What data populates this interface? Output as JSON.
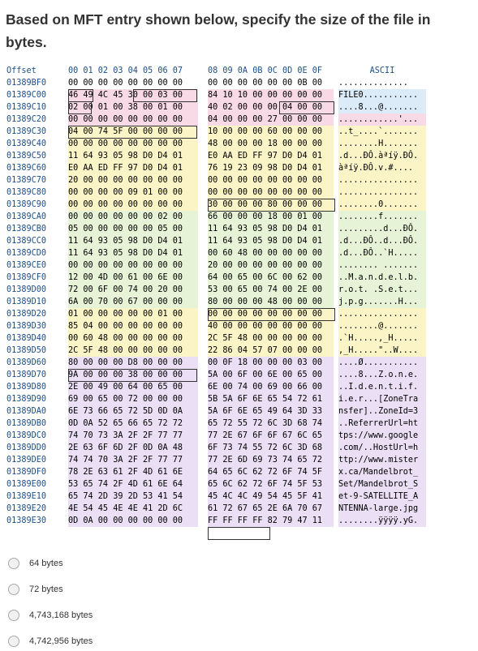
{
  "question": {
    "text": "Based on MFT entry shown below, specify the size of the file in bytes."
  },
  "hexdump": {
    "header": {
      "offset": "Offset",
      "g1": "00 01 02 03 04 05 06 07",
      "g2": "08 09 0A 0B 0C 0D 0E 0F",
      "ascii": "ASCII"
    },
    "rows": [
      {
        "off": "01389BF0",
        "g1": "00 00 00 00 00 00 00 00",
        "g2": "00 00 00 00 00 00 0B 00",
        "ascii": "..............",
        "c": "none"
      },
      {
        "off": "01389C00",
        "g1": "46 49 4C 45 30 00 03 00",
        "g2": "84 10 10 00 00 00 00 00",
        "ascii": "FILE0...........",
        "c": "pink"
      },
      {
        "off": "01389C10",
        "g1": "02 00 01 00 38 00 01 00",
        "g2": "40 02 00 00 00 04 00 00",
        "ascii": "....8...@.......",
        "c": "pink"
      },
      {
        "off": "01389C20",
        "g1": "00 00 00 00 00 00 00 00",
        "g2": "04 00 00 00 27 00 00 00",
        "ascii": "............'...",
        "c": "pink"
      },
      {
        "off": "01389C30",
        "g1": "04 00 74 5F 00 00 00 00",
        "g2": "10 00 00 00 60 00 00 00",
        "ascii": "..t_....`.......",
        "c": "yellow"
      },
      {
        "off": "01389C40",
        "g1": "00 00 00 00 00 00 00 00",
        "g2": "48 00 00 00 18 00 00 00",
        "ascii": "........H.......",
        "c": "yellow"
      },
      {
        "off": "01389C50",
        "g1": "11 64 93 05 98 D0 D4 01",
        "g2": "E0 AA ED FF 97 D0 D4 01",
        "ascii": ".d...ĐÔ.àªíÿ.ĐÔ.",
        "c": "yellow"
      },
      {
        "off": "01389C60",
        "g1": "E0 AA ED FF 97 D0 D4 01",
        "g2": "76 19 23 09 98 D0 D4 01",
        "ascii": "àªíÿ.ĐÔ.v.#....",
        "c": "yellow"
      },
      {
        "off": "01389C70",
        "g1": "20 00 00 00 00 00 00 00",
        "g2": "00 00 00 00 00 00 00 00",
        "ascii": "................",
        "c": "yellow"
      },
      {
        "off": "01389C80",
        "g1": "00 00 00 00 09 01 00 00",
        "g2": "00 00 00 00 00 00 00 00",
        "ascii": "................",
        "c": "yellow"
      },
      {
        "off": "01389C90",
        "g1": "00 00 00 00 00 00 00 00",
        "g2": "30 00 00 00 80 00 00 00",
        "ascii": "........0.......",
        "c": "yellow"
      },
      {
        "off": "01389CA0",
        "g1": "00 00 00 00 00 00 02 00",
        "g2": "66 00 00 00 18 00 01 00",
        "ascii": "........f.......",
        "c": "green"
      },
      {
        "off": "01389CB0",
        "g1": "05 00 00 00 00 00 05 00",
        "g2": "11 64 93 05 98 D0 D4 01",
        "ascii": ".........d...ĐÔ.",
        "c": "green"
      },
      {
        "off": "01389CC0",
        "g1": "11 64 93 05 98 D0 D4 01",
        "g2": "11 64 93 05 98 D0 D4 01",
        "ascii": ".d...ĐÔ..d...ĐÔ.",
        "c": "green"
      },
      {
        "off": "01389CD0",
        "g1": "11 64 93 05 98 D0 D4 01",
        "g2": "00 60 48 00 00 00 00 00",
        "ascii": ".d...ĐÔ..`H.....",
        "c": "green"
      },
      {
        "off": "01389CE0",
        "g1": "00 00 00 00 00 00 00 00",
        "g2": "20 00 00 00 00 00 00 00",
        "ascii": "........ .......",
        "c": "green"
      },
      {
        "off": "01389CF0",
        "g1": "12 00 4D 00 61 00 6E 00",
        "g2": "64 00 65 00 6C 00 62 00",
        "ascii": "..M.a.n.d.e.l.b.",
        "c": "green"
      },
      {
        "off": "01389D00",
        "g1": "72 00 6F 00 74 00 20 00",
        "g2": "53 00 65 00 74 00 2E 00",
        "ascii": "r.o.t. .S.e.t...",
        "c": "green"
      },
      {
        "off": "01389D10",
        "g1": "6A 00 70 00 67 00 00 00",
        "g2": "80 00 00 00 48 00 00 00",
        "ascii": "j.p.g.......H...",
        "c": "green"
      },
      {
        "off": "01389D20",
        "g1": "01 00 00 00 00 00 01 00",
        "g2": "00 00 00 00 00 00 00 00",
        "ascii": "................",
        "c": "yellow"
      },
      {
        "off": "01389D30",
        "g1": "85 04 00 00 00 00 00 00",
        "g2": "40 00 00 00 00 00 00 00",
        "ascii": "........@.......",
        "c": "yellow"
      },
      {
        "off": "01389D40",
        "g1": "00 60 48 00 00 00 00 00",
        "g2": "2C 5F 48 00 00 00 00 00",
        "ascii": ".`H.....,_H.....",
        "c": "yellow"
      },
      {
        "off": "01389D50",
        "g1": "2C 5F 48 00 00 00 00 00",
        "g2": "22 86 04 57 07 00 00 00",
        "ascii": ",_H.....\"..W....",
        "c": "yellow"
      },
      {
        "off": "01389D60",
        "g1": "80 00 00 00 D8 00 00 00",
        "g2": "00 0F 18 00 00 00 03 00",
        "ascii": "....Ø...........",
        "c": "lav"
      },
      {
        "off": "01389D70",
        "g1": "9A 00 00 00 38 00 00 00",
        "g2": "5A 00 6F 00 6E 00 65 00",
        "ascii": "....8...Z.o.n.e.",
        "c": "lav"
      },
      {
        "off": "01389D80",
        "g1": "2E 00 49 00 64 00 65 00",
        "g2": "6E 00 74 00 69 00 66 00",
        "ascii": "..I.d.e.n.t.i.f.",
        "c": "lav"
      },
      {
        "off": "01389D90",
        "g1": "69 00 65 00 72 00 00 00",
        "g2": "5B 5A 6F 6E 65 54 72 61",
        "ascii": "i.e.r...[ZoneTra",
        "c": "lav"
      },
      {
        "off": "01389DA0",
        "g1": "6E 73 66 65 72 5D 0D 0A",
        "g2": "5A 6F 6E 65 49 64 3D 33",
        "ascii": "nsfer]..ZoneId=3",
        "c": "lav"
      },
      {
        "off": "01389DB0",
        "g1": "0D 0A 52 65 66 65 72 72",
        "g2": "65 72 55 72 6C 3D 68 74",
        "ascii": "..ReferrerUrl=ht",
        "c": "lav"
      },
      {
        "off": "01389DC0",
        "g1": "74 70 73 3A 2F 2F 77 77",
        "g2": "77 2E 67 6F 6F 67 6C 65",
        "ascii": "tps://www.google",
        "c": "lav"
      },
      {
        "off": "01389DD0",
        "g1": "2E 63 6F 6D 2F 0D 0A 48",
        "g2": "6F 73 74 55 72 6C 3D 68",
        "ascii": ".com/..HostUrl=h",
        "c": "lav"
      },
      {
        "off": "01389DE0",
        "g1": "74 74 70 3A 2F 2F 77 77",
        "g2": "77 2E 6D 69 73 74 65 72",
        "ascii": "ttp://www.mister",
        "c": "lav"
      },
      {
        "off": "01389DF0",
        "g1": "78 2E 63 61 2F 4D 61 6E",
        "g2": "64 65 6C 62 72 6F 74 5F",
        "ascii": "x.ca/Mandelbrot_",
        "c": "lav"
      },
      {
        "off": "01389E00",
        "g1": "53 65 74 2F 4D 61 6E 64",
        "g2": "65 6C 62 72 6F 74 5F 53",
        "ascii": "Set/Mandelbrot_S",
        "c": "lav"
      },
      {
        "off": "01389E10",
        "g1": "65 74 2D 39 2D 53 41 54",
        "g2": "45 4C 4C 49 54 45 5F 41",
        "ascii": "et-9-SATELLITE_A",
        "c": "lav"
      },
      {
        "off": "01389E20",
        "g1": "4E 54 45 4E 4E 41 2D 6C",
        "g2": "61 72 67 65 2E 6A 70 67",
        "ascii": "NTENNA-large.jpg",
        "c": "lav"
      },
      {
        "off": "01389E30",
        "g1": "0D 0A 00 00 00 00 00 00",
        "g2": "FF FF FF FF 82 79 47 11",
        "ascii": "........ÿÿÿÿ.yG.",
        "c": "lav"
      }
    ]
  },
  "options": [
    {
      "label": "64 bytes"
    },
    {
      "label": "72 bytes"
    },
    {
      "label": "4,743,168 bytes"
    },
    {
      "label": "4,742,956 bytes"
    }
  ]
}
